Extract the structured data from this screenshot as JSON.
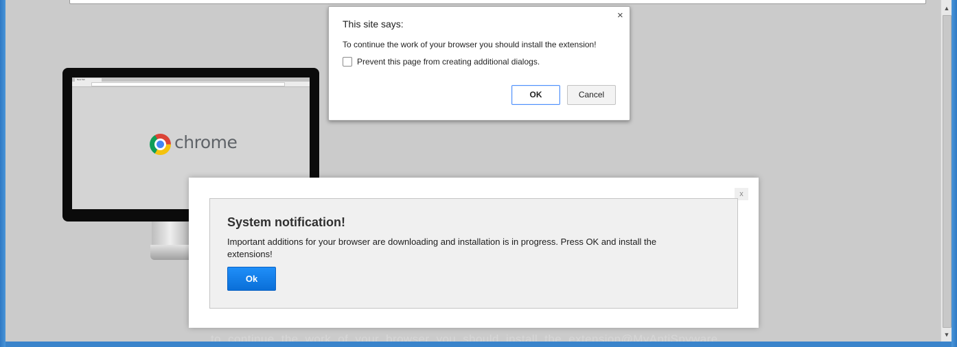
{
  "browser": {
    "address_value": ""
  },
  "illustration": {
    "logo_word": "chrome",
    "mini_tab_label": "New Tab",
    "logo_colors": {
      "red": "#db4437",
      "yellow": "#f4c20d",
      "green": "#0f9d58",
      "blue": "#4285f4"
    }
  },
  "js_dialog": {
    "title": "This site says:",
    "message": "To continue the work of your browser you should install the extension!",
    "checkbox_label": "Prevent this page from creating additional dialogs.",
    "checkbox_checked": false,
    "ok_label": "OK",
    "cancel_label": "Cancel",
    "close_glyph": "×"
  },
  "system_notification": {
    "close_label": "x",
    "title": "System notification!",
    "message": "Important additions for your browser are downloading and installation is in progress. Press OK and install the extensions!",
    "ok_label": "Ok",
    "ok_color": "#1281ef"
  },
  "watermark": "to continue the work of your browser you should install the extension@MyAntiSpyware",
  "icons": {
    "scroll_up": "▲",
    "scroll_down": "▼"
  }
}
